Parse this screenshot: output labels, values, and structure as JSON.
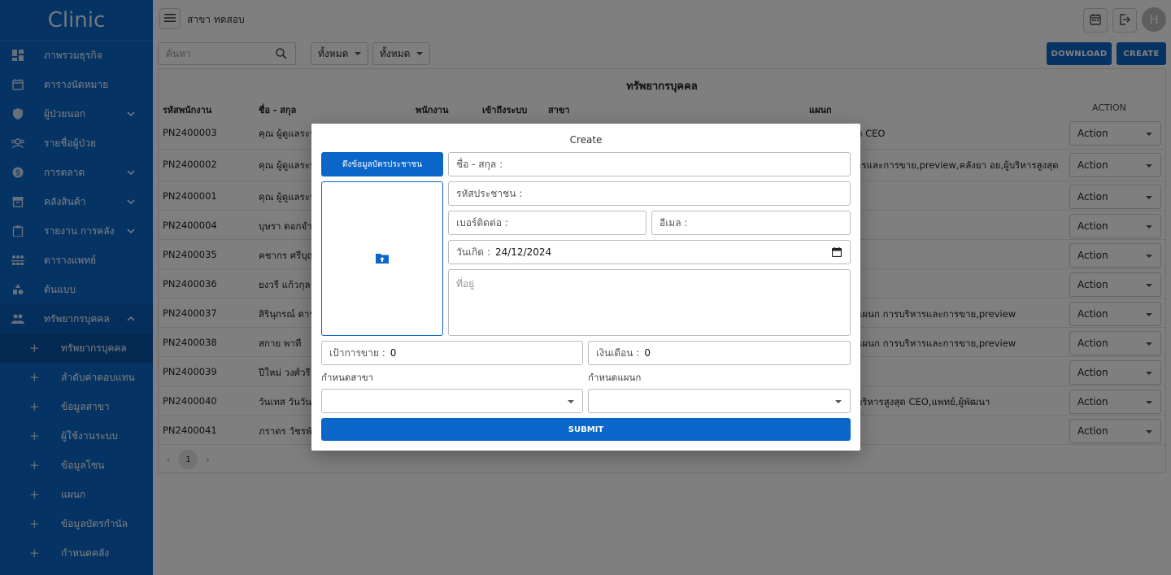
{
  "app": {
    "brand": "Clinic",
    "branch_title": "สาขา ทดสอบ",
    "avatar_letter": "H"
  },
  "sidebar": {
    "items": [
      {
        "label": "ภาพรวมธุรกิจ",
        "icon": "dashboard-icon"
      },
      {
        "label": "ตารางนัดหมาย",
        "icon": "calendar-icon"
      },
      {
        "label": "ผู้ป่วยนอก",
        "icon": "shield-icon",
        "expandable": true
      },
      {
        "label": "รายชื่อผู้ป่วย",
        "icon": "patients-icon"
      },
      {
        "label": "การตลาด",
        "icon": "dollar-icon",
        "expandable": true
      },
      {
        "label": "คลังสินค้า",
        "icon": "inventory-icon",
        "expandable": true
      },
      {
        "label": "รายงาน การคลัง",
        "icon": "clipboard-icon",
        "expandable": true
      },
      {
        "label": "ตารางแพทย์",
        "icon": "doctor-schedule-icon"
      },
      {
        "label": "ต้นแบบ",
        "icon": "template-icon"
      },
      {
        "label": "ทรัพยากรบุคคล",
        "icon": "people-icon",
        "expanded": true
      }
    ],
    "subitems": [
      {
        "label": "ทรัพยากรบุคคล",
        "current": true
      },
      {
        "label": "ลำดับค่าตอบแทน"
      },
      {
        "label": "ข้อมูลสาขา"
      },
      {
        "label": "ผู้ใช้งานระบบ"
      },
      {
        "label": "ข้อมูลโซน"
      },
      {
        "label": "แผนก"
      },
      {
        "label": "ข้อมูลบัตรกำนัล"
      },
      {
        "label": "กำหนดคลัง"
      }
    ]
  },
  "toolbar": {
    "search_placeholder": "ค้นหา",
    "filter1": "ทั้งหมด",
    "filter2": "ทั้งหมด",
    "download_label": "DOWNLOAD",
    "create_label": "CREATE"
  },
  "table": {
    "title": "ทรัพยากรบุคคล",
    "headers": {
      "code": "รหัสพนักงาน",
      "name": "ชื่อ - สกุล",
      "employee": "พนักงาน",
      "access": "เข้าถึงระบบ",
      "branch": "สาขา",
      "department": "แผนก",
      "action": "ACTION"
    },
    "action_label": "Action",
    "rows": [
      {
        "code": "PN2400003",
        "name": "คุณ ผู้ดูแลระบ",
        "dept": "ด CEO"
      },
      {
        "code": "PN2400002",
        "name": "คุณ ผู้ดูแลระบ",
        "dept": "ารและการขาย,preview,คลังยา อย,ผู้บริหารสูงสุด"
      },
      {
        "code": "PN2400001",
        "name": "คุณ ผู้ดูแลระบ",
        "dept": ""
      },
      {
        "code": "PN2400004",
        "name": "บุษรา ดอกจำป",
        "dept": ""
      },
      {
        "code": "PN2400035",
        "name": "คชากร ศรีบุญ",
        "dept": ""
      },
      {
        "code": "PN2400036",
        "name": "ยงวรี แก้วกุล",
        "dept": ""
      },
      {
        "code": "PN2400037",
        "name": "สิรินุกรณ์ ดาร",
        "dept": "แผนก การบริหารและการขาย,preview"
      },
      {
        "code": "PN2400038",
        "name": "สกาย พาที",
        "dept": "แผนก การบริหารและการขาย,preview"
      },
      {
        "code": "PN2400039",
        "name": "ปีใหม่ วงศ์วรี",
        "dept": ""
      },
      {
        "code": "PN2400040",
        "name": "วันเทส วันวัน",
        "dept": "บริหารสูงสุด CEO,แพทย์,ผู้พัฒนา"
      },
      {
        "code": "PN2400041",
        "name": "ภราดร วัชรพั",
        "dept": ""
      }
    ],
    "page": "1"
  },
  "modal": {
    "title": "Create",
    "fetch_button": "ดึงข้อมูลบัตรประชาชน",
    "upload_icon": "folder-upload-icon",
    "fields": {
      "fullname_label": "ชื่อ - สกุล :",
      "citizen_id_label": "รหัสประชาชน :",
      "phone_label": "เบอร์ติดต่อ :",
      "email_label": "อีเมล :",
      "birthdate_label": "วันเกิด :",
      "birthdate_value": "24/12/2024",
      "address_placeholder": "ที่อยู่",
      "sales_target_label": "เป้าการขาย :",
      "sales_target_value": "0",
      "salary_label": "เงินเดือน :",
      "salary_value": "0",
      "branch_select_label": "กำหนดสาขา",
      "department_select_label": "กำหนดแผนก"
    },
    "submit_label": "SUBMIT"
  },
  "colors": {
    "primary": "#0a66c9",
    "overlay": "rgba(0,0,0,0.5)"
  }
}
